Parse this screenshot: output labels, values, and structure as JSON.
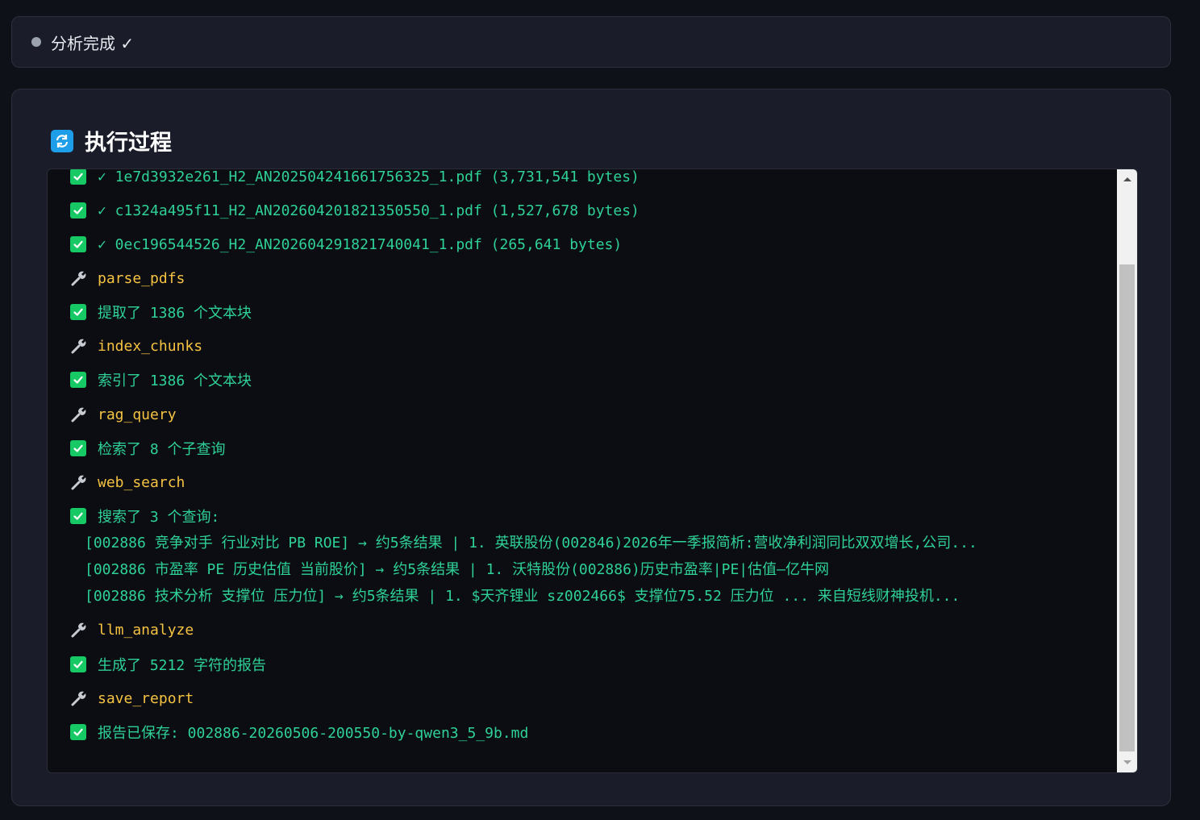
{
  "status": {
    "text": "分析完成 ✓"
  },
  "panel": {
    "title": "执行过程",
    "icon": "refresh-icon"
  },
  "log": {
    "lines": [
      {
        "type": "check",
        "text": "✓ 1e7d3932e261_H2_AN202504241661756325_1.pdf (3,731,541 bytes)"
      },
      {
        "type": "check",
        "text": "✓ c1324a495f11_H2_AN202604201821350550_1.pdf (1,527,678 bytes)"
      },
      {
        "type": "check",
        "text": "✓ 0ec196544526_H2_AN202604291821740041_1.pdf (265,641 bytes)"
      },
      {
        "type": "tool",
        "text": "parse_pdfs"
      },
      {
        "type": "check",
        "text": "提取了 1386 个文本块"
      },
      {
        "type": "tool",
        "text": "index_chunks"
      },
      {
        "type": "check",
        "text": "索引了 1386 个文本块"
      },
      {
        "type": "tool",
        "text": "rag_query"
      },
      {
        "type": "check",
        "text": "检索了 8 个子查询"
      },
      {
        "type": "tool",
        "text": "web_search"
      },
      {
        "type": "check",
        "text": "搜索了 3 个查询:"
      },
      {
        "type": "sub",
        "text": "[002886 竞争对手 行业对比 PB ROE] → 约5条结果 | 1. 英联股份(002846)2026年一季报简析:营收净利润同比双双增长,公司..."
      },
      {
        "type": "sub",
        "text": "[002886 市盈率 PE 历史估值 当前股价] → 约5条结果 | 1. 沃特股份(002886)历史市盈率|PE|估值—亿牛网"
      },
      {
        "type": "sub",
        "text": "[002886 技术分析 支撑位 压力位] → 约5条结果 | 1. $天齐锂业 sz002466$ 支撑位75.52 压力位 ... 来自短线财神投机..."
      },
      {
        "type": "tool",
        "text": "llm_analyze"
      },
      {
        "type": "check",
        "text": "生成了 5212 字符的报告"
      },
      {
        "type": "tool",
        "text": "save_report"
      },
      {
        "type": "check",
        "text": "报告已保存: 002886-20260506-200550-by-qwen3_5_9b.md"
      }
    ]
  }
}
